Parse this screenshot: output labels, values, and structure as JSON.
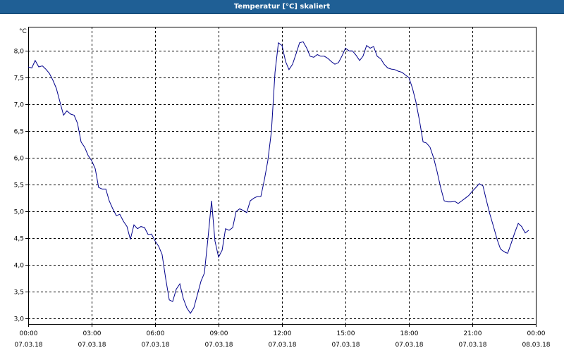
{
  "window": {
    "title": "Temperatur [°C] skaliert"
  },
  "chart_data": {
    "type": "line",
    "title": "Temperatur [°C] skaliert",
    "ylabel": "°C",
    "ylim": [
      2.9,
      8.45
    ],
    "xlim": [
      0,
      24
    ],
    "grid": true,
    "line_color": "#00008b",
    "y_ticks": [
      "3,0",
      "3,5",
      "4,0",
      "4,5",
      "5,0",
      "5,5",
      "6,0",
      "6,5",
      "7,0",
      "7,5",
      "8,0"
    ],
    "y_tick_values": [
      3.0,
      3.5,
      4.0,
      4.5,
      5.0,
      5.5,
      6.0,
      6.5,
      7.0,
      7.5,
      8.0
    ],
    "x_ticks": [
      {
        "time": "00:00",
        "date": "07.03.18"
      },
      {
        "time": "03:00",
        "date": "07.03.18"
      },
      {
        "time": "06:00",
        "date": "07.03.18"
      },
      {
        "time": "09:00",
        "date": "07.03.18"
      },
      {
        "time": "12:00",
        "date": "07.03.18"
      },
      {
        "time": "15:00",
        "date": "07.03.18"
      },
      {
        "time": "18:00",
        "date": "07.03.18"
      },
      {
        "time": "21:00",
        "date": "07.03.18"
      },
      {
        "time": "00:00",
        "date": "08.03.18"
      }
    ],
    "x_tick_hours": [
      0,
      3,
      6,
      9,
      12,
      15,
      18,
      21,
      24
    ],
    "series": [
      {
        "x": [
          0.0,
          0.17,
          0.33,
          0.5,
          0.67,
          0.83,
          1.0,
          1.17,
          1.33,
          1.5,
          1.67,
          1.83,
          2.0,
          2.17,
          2.33,
          2.5,
          2.67,
          2.83,
          3.0,
          3.17,
          3.33,
          3.5,
          3.67,
          3.83,
          4.0,
          4.17,
          4.33,
          4.5,
          4.67,
          4.83,
          5.0,
          5.17,
          5.33,
          5.5,
          5.67,
          5.83,
          6.0,
          6.17,
          6.33,
          6.5,
          6.67,
          6.83,
          7.0,
          7.17,
          7.33,
          7.5,
          7.67,
          7.83,
          8.0,
          8.17,
          8.33,
          8.5,
          8.67,
          8.83,
          9.0,
          9.17,
          9.33,
          9.5,
          9.67,
          9.83,
          10.0,
          10.17,
          10.33,
          10.5,
          10.67,
          10.83,
          11.0,
          11.17,
          11.33,
          11.5,
          11.67,
          11.83,
          12.0,
          12.17,
          12.33,
          12.5,
          12.67,
          12.83,
          13.0,
          13.17,
          13.33,
          13.5,
          13.67,
          13.83,
          14.0,
          14.17,
          14.33,
          14.5,
          14.67,
          14.83,
          15.0,
          15.17,
          15.33,
          15.5,
          15.67,
          15.83,
          16.0,
          16.17,
          16.33,
          16.5,
          16.67,
          16.83,
          17.0,
          17.17,
          17.33,
          17.5,
          17.67,
          17.83,
          18.0,
          18.17,
          18.33,
          18.5,
          18.67,
          18.83,
          19.0,
          19.17,
          19.33,
          19.5,
          19.67,
          19.83,
          20.0,
          20.17,
          20.33,
          20.5,
          20.67,
          20.83,
          21.0,
          21.17,
          21.33,
          21.5,
          21.67,
          21.83,
          22.0,
          22.17,
          22.33,
          22.5,
          22.67,
          22.83,
          23.0,
          23.17,
          23.33,
          23.5,
          23.67
        ],
        "y": [
          7.7,
          7.68,
          7.82,
          7.7,
          7.72,
          7.66,
          7.58,
          7.45,
          7.3,
          7.05,
          6.8,
          6.88,
          6.82,
          6.8,
          6.65,
          6.3,
          6.2,
          6.05,
          5.95,
          5.8,
          5.45,
          5.42,
          5.42,
          5.2,
          5.05,
          4.92,
          4.95,
          4.82,
          4.72,
          4.48,
          4.75,
          4.68,
          4.72,
          4.7,
          4.57,
          4.58,
          4.45,
          4.35,
          4.2,
          3.75,
          3.35,
          3.32,
          3.55,
          3.65,
          3.38,
          3.2,
          3.1,
          3.2,
          3.45,
          3.7,
          3.85,
          4.5,
          5.2,
          4.45,
          4.15,
          4.28,
          4.68,
          4.65,
          4.7,
          5.0,
          5.05,
          5.02,
          4.98,
          5.2,
          5.25,
          5.28,
          5.28,
          5.6,
          5.95,
          6.5,
          7.6,
          8.15,
          8.1,
          7.8,
          7.65,
          7.75,
          7.95,
          8.15,
          8.17,
          8.05,
          7.9,
          7.88,
          7.93,
          7.9,
          7.9,
          7.86,
          7.8,
          7.75,
          7.78,
          7.9,
          8.05,
          8.0,
          8.0,
          7.92,
          7.82,
          7.9,
          8.1,
          8.05,
          8.08,
          7.9,
          7.85,
          7.75,
          7.68,
          7.66,
          7.65,
          7.62,
          7.6,
          7.55,
          7.5,
          7.3,
          7.05,
          6.7,
          6.3,
          6.28,
          6.2,
          6.0,
          5.75,
          5.45,
          5.2,
          5.18,
          5.18,
          5.19,
          5.15,
          5.2,
          5.25,
          5.3,
          5.38,
          5.45,
          5.52,
          5.48,
          5.2,
          4.95,
          4.72,
          4.48,
          4.3,
          4.25,
          4.22,
          4.4,
          4.6,
          4.78,
          4.72,
          4.6,
          4.65
        ]
      }
    ]
  }
}
